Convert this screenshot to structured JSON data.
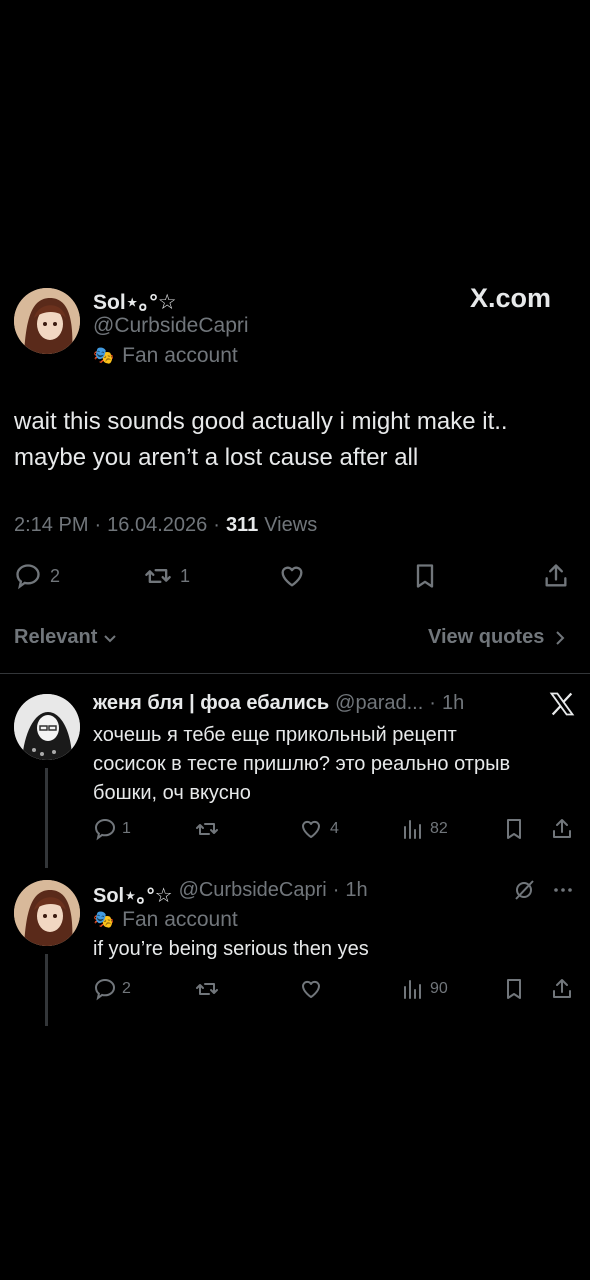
{
  "main_post": {
    "display_name": "Sol⋆｡°☆",
    "handle": "@CurbsideCapri",
    "badge": "Fan account",
    "watermark": "X.com",
    "text_line1": "wait this sounds good actually i might make it..",
    "text_line2": "maybe you aren’t a lost cause after all",
    "time": "2:14 PM",
    "date": "16.04.2026",
    "views_count": "311",
    "views_label": "Views",
    "reply_count": "2",
    "repost_count": "1"
  },
  "filter": {
    "sort_label": "Relevant",
    "view_quotes": "View quotes"
  },
  "reply1": {
    "display_name": "женя бля | фоа ебались",
    "handle": "@parad...",
    "time": "1h",
    "text_line1": "хочешь я тебе еще прикольный рецепт",
    "text_line2": "сосисок в тесте пришлю? это реально отрыв",
    "text_line3": "бошки, оч вкусно",
    "reply_count": "1",
    "like_count": "4",
    "views_count": "82"
  },
  "reply2": {
    "display_name": "Sol⋆｡°☆",
    "handle": "@CurbsideCapri",
    "time": "1h",
    "badge": "Fan account",
    "text": "if you’re being serious then yes",
    "reply_count": "2",
    "views_count": "90"
  }
}
